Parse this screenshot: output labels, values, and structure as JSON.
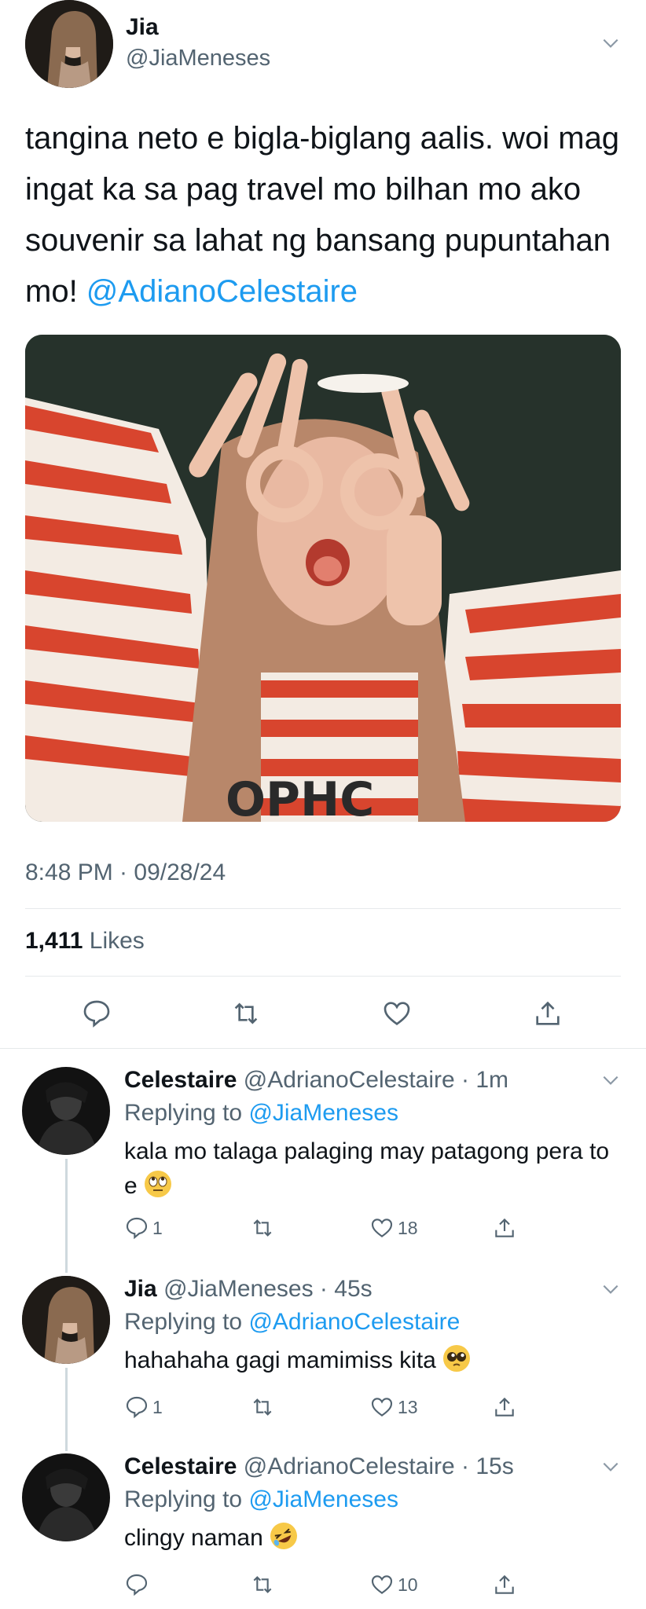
{
  "main_tweet": {
    "name": "Jia",
    "handle": "@JiaMeneses",
    "text_parts": [
      "tangina neto e bigla-biglang aalis. woi mag ingat ka sa pag travel mo bilhan mo ako souvenir sa lahat ng bansang pupuntahan mo! ",
      "@AdianoCelestaire"
    ],
    "photo_caption_text": "OPHC",
    "timestamp": "8:48 PM · 09/28/24",
    "likes_count": "1,411",
    "likes_label": "Likes",
    "icons": [
      "reply-icon",
      "retweet-icon",
      "like-icon",
      "share-icon"
    ]
  },
  "replies": [
    {
      "name": "Celestaire",
      "meta": "@AdrianoCelestaire · 1m",
      "replying_label": "Replying to",
      "replying_to": "@JiaMeneses",
      "text": "kala mo talaga palaging may patagong pera to e",
      "emoji": "rolling-eyes-emoji",
      "reply_count": "1",
      "retweet_count": "",
      "like_count": "18"
    },
    {
      "name": "Jia",
      "meta": "@JiaMeneses · 45s",
      "replying_label": "Replying to",
      "replying_to": "@AdrianoCelestaire",
      "text": "hahahaha gagi mamimiss kita",
      "emoji": "pleading-face-emoji",
      "reply_count": "1",
      "retweet_count": "",
      "like_count": "13"
    },
    {
      "name": "Celestaire",
      "meta": "@AdrianoCelestaire · 15s",
      "replying_label": "Replying to",
      "replying_to": "@JiaMeneses",
      "text": "clingy naman",
      "emoji": "rofl-emoji",
      "reply_count": "",
      "retweet_count": "",
      "like_count": "10"
    }
  ],
  "colors": {
    "link": "#1d9bf0",
    "secondary_text": "#536471",
    "primary_text": "#0f1419"
  }
}
